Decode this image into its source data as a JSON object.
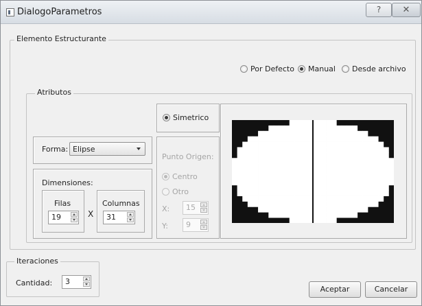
{
  "window": {
    "title": "DialogoParametros",
    "help_label": "?",
    "close_label": "✕"
  },
  "elemento": {
    "group_title": "Elemento Estructurante",
    "source_options": [
      {
        "label": "Por Defecto",
        "checked": false
      },
      {
        "label": "Manual",
        "checked": true
      },
      {
        "label": "Desde archivo",
        "checked": false
      }
    ]
  },
  "atributos": {
    "group_title": "Atributos",
    "forma_label": "Forma:",
    "forma_value": "Elipse",
    "dimensiones_label": "Dimensiones:",
    "filas_label": "Filas",
    "filas_value": "19",
    "x_sep": "X",
    "columnas_label": "Columnas",
    "columnas_value": "31",
    "simetrico_label": "Simetrico",
    "simetrico_checked": true,
    "origen": {
      "title": "Punto Origen:",
      "centro_label": "Centro",
      "otro_label": "Otro",
      "x_label": "X:",
      "x_value": "15",
      "y_label": "Y:",
      "y_value": "9"
    }
  },
  "iteraciones": {
    "group_title": "Iteraciones",
    "cantidad_label": "Cantidad:",
    "cantidad_value": "3"
  },
  "buttons": {
    "accept_label": "Aceptar",
    "cancel_label": "Cancelar"
  },
  "colors": {
    "mask_fg": "#ffffff",
    "mask_bg": "#111111"
  }
}
